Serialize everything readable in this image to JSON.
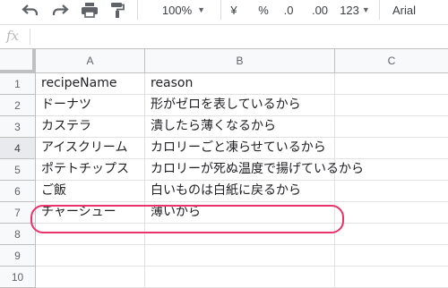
{
  "toolbar": {
    "zoom": "100%",
    "currency": "¥",
    "percent": "%",
    "decrease_decimals": ".0",
    "increase_decimals": ".00",
    "more_formats": "123",
    "font": "Arial"
  },
  "formula_bar": {
    "fx_label": "fx",
    "value": ""
  },
  "grid": {
    "columns": [
      "A",
      "B",
      "C"
    ],
    "rows": [
      {
        "num": "1",
        "a": "recipeName",
        "b": "reason",
        "c": ""
      },
      {
        "num": "2",
        "a": "ドーナツ",
        "b": "形がゼロを表しているから",
        "c": ""
      },
      {
        "num": "3",
        "a": "カステラ",
        "b": "潰したら薄くなるから",
        "c": ""
      },
      {
        "num": "4",
        "a": "アイスクリーム",
        "b": "カロリーごと凍らせているから",
        "c": ""
      },
      {
        "num": "5",
        "a": "ポテトチップス",
        "b": "カロリーが死ぬ温度で揚げているから",
        "c": ""
      },
      {
        "num": "6",
        "a": "ご飯",
        "b": "白いものは白紙に戻るから",
        "c": ""
      },
      {
        "num": "7",
        "a": "チャーシュー",
        "b": "薄いから",
        "c": ""
      },
      {
        "num": "8",
        "a": "",
        "b": "",
        "c": ""
      },
      {
        "num": "9",
        "a": "",
        "b": "",
        "c": ""
      },
      {
        "num": "10",
        "a": "",
        "b": "",
        "c": ""
      }
    ],
    "selected_row": "4"
  },
  "colors": {
    "highlight": "#e8336b",
    "header_bg": "#f8f9fa",
    "grid_line": "#e2e2e2"
  }
}
